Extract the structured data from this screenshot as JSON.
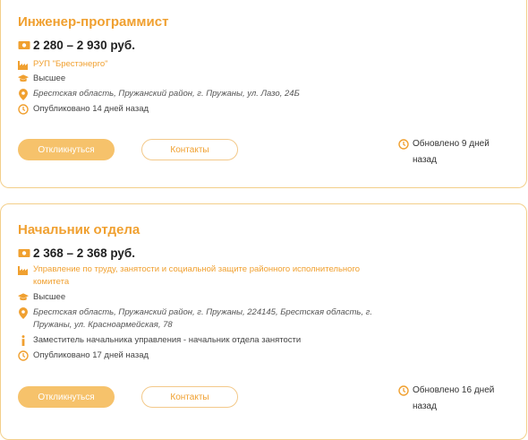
{
  "vacancies": [
    {
      "title": "Инженер-программист",
      "salary": "2 280 – 2 930 руб.",
      "organization": "РУП \"Брестэнерго\"",
      "education": "Высшее",
      "address": "Брестская область, Пружанский район, г. Пружаны, ул. Лазо, 24Б",
      "published": "Опубликовано 14 дней назад",
      "apply_label": "Откликнуться",
      "contacts_label": "Контакты",
      "updated": "Обновлено 9 дней назад"
    },
    {
      "title": "Начальник отдела",
      "salary": "2 368 – 2 368 руб.",
      "organization": "Управление по труду, занятости и социальной защите районного исполнительного комитета",
      "education": "Высшее",
      "address": "Брестская область, Пружанский район, г. Пружаны, 224145, Брестская область, г. Пружаны, ул. Красноармейская, 78",
      "info": "Заместитель начальника управления - начальник отдела занятости",
      "published": "Опубликовано 17 дней назад",
      "apply_label": "Откликнуться",
      "contacts_label": "Контакты",
      "updated": "Обновлено 16 дней назад"
    }
  ],
  "icons": {
    "salary": "money-icon",
    "organization": "factory-icon",
    "education": "graduation-cap-icon",
    "address": "location-pin-icon",
    "info": "info-icon",
    "time": "clock-icon"
  },
  "colors": {
    "accent": "#f0a030",
    "button_fill": "#f6c26b",
    "border": "#f3cf8a"
  }
}
